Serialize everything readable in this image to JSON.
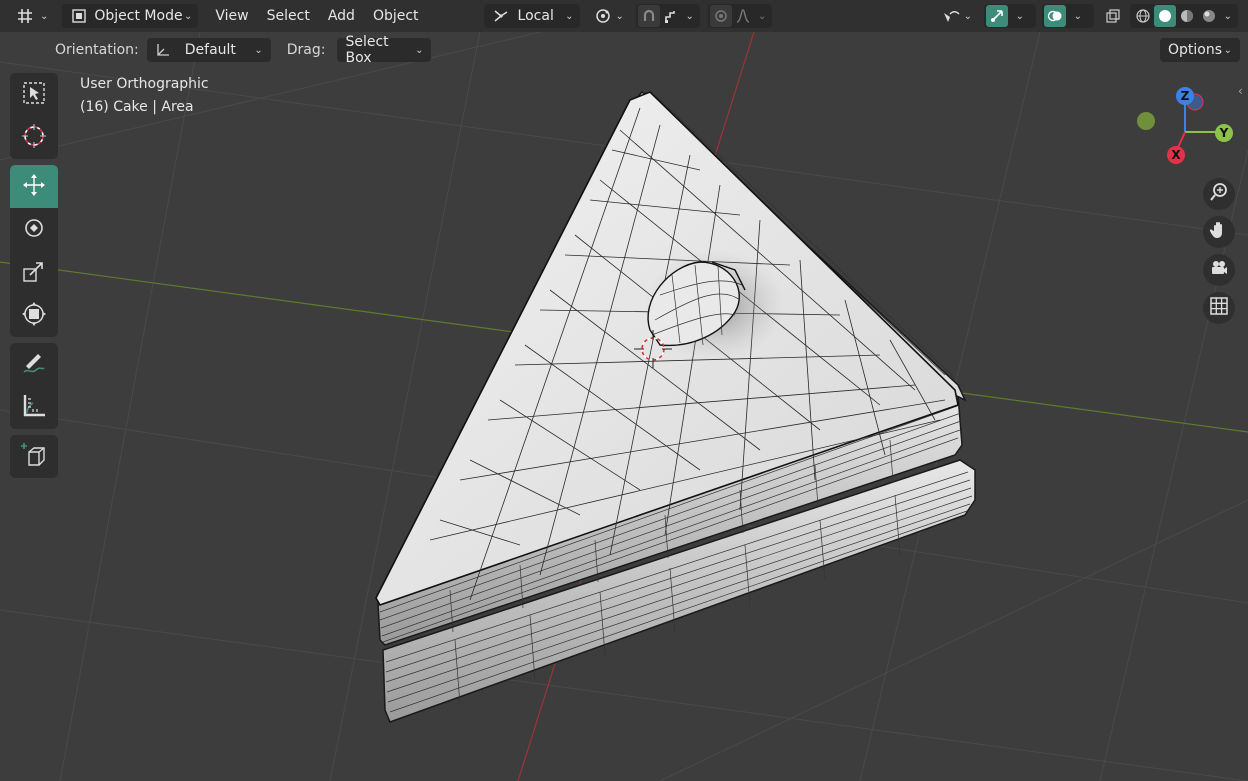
{
  "topbar": {
    "editor_type_icon": "grid-editor-icon",
    "mode_label": "Object Mode",
    "menus": [
      "View",
      "Select",
      "Add",
      "Object"
    ],
    "transform_orientation": "Local",
    "options_label": "Options"
  },
  "header2": {
    "orientation_label": "Orientation:",
    "orientation_value": "Default",
    "drag_label": "Drag:",
    "drag_value": "Select Box"
  },
  "viewport": {
    "view_name": "User Orthographic",
    "object_info": "(16) Cake | Area"
  },
  "gizmo": {
    "z": "Z",
    "y": "Y",
    "x": "X"
  },
  "tools": [
    "select-box-icon",
    "cursor-icon",
    "move-icon",
    "rotate-icon",
    "scale-icon",
    "transform-icon",
    "annotate-icon",
    "measure-icon",
    "add-cube-icon"
  ],
  "colors": {
    "active_tool": "#3d8c7a",
    "axis_x": "#e2324a",
    "axis_y": "#8bc34a",
    "axis_z": "#3c82e6"
  }
}
